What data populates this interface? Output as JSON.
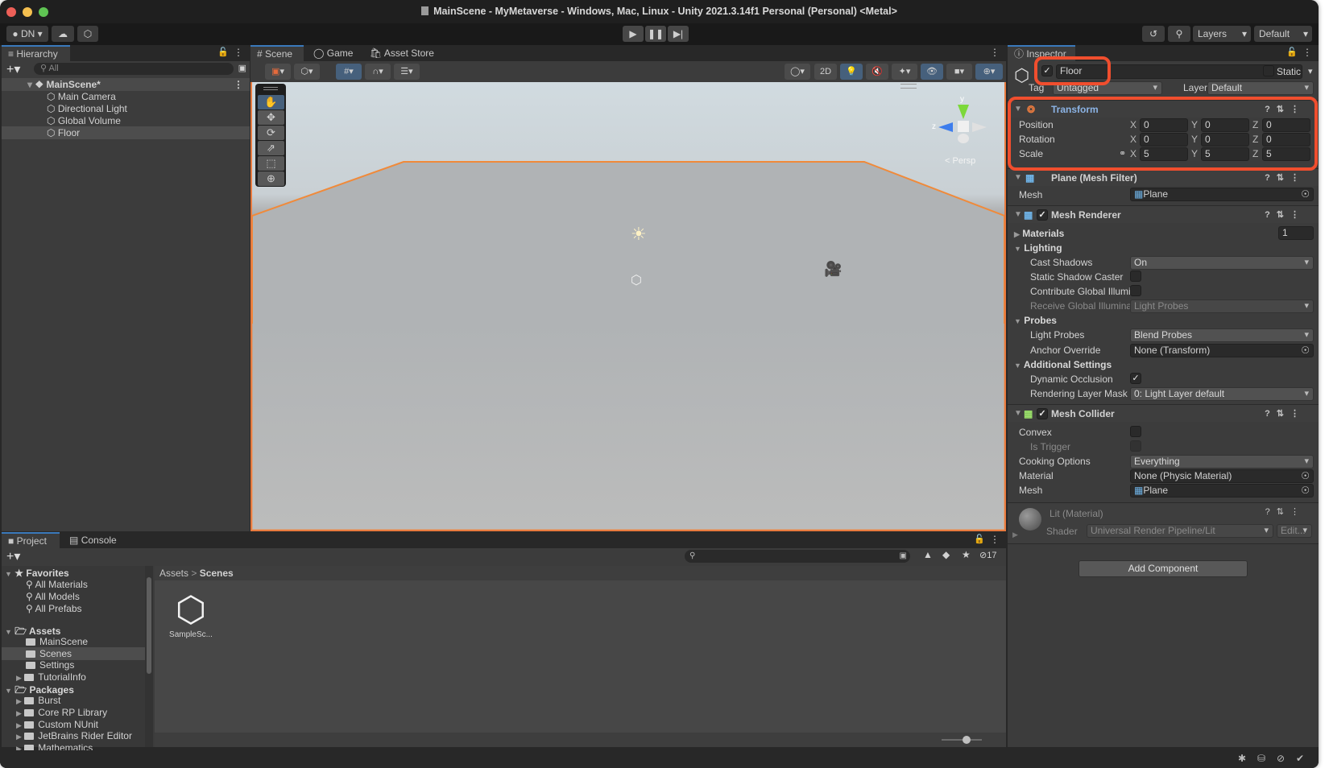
{
  "window": {
    "title": "MainScene - MyMetaverse - Windows, Mac, Linux - Unity 2021.3.14f1 Personal (Personal) <Metal>"
  },
  "toolbar": {
    "account_label": "DN",
    "layers_label": "Layers",
    "layout_label": "Default"
  },
  "hierarchy": {
    "tab_label": "Hierarchy",
    "search_placeholder": "All",
    "scene_name": "MainScene*",
    "items": [
      {
        "label": "Main Camera"
      },
      {
        "label": "Directional Light"
      },
      {
        "label": "Global Volume"
      },
      {
        "label": "Floor",
        "selected": true
      }
    ]
  },
  "scene_view": {
    "tabs": [
      {
        "label": "Scene",
        "active": true
      },
      {
        "label": "Game"
      },
      {
        "label": "Asset Store"
      }
    ],
    "mode_2d_label": "2D",
    "gizmo_y_label": "y",
    "gizmo_z_label": "z",
    "projection_label": "Persp"
  },
  "inspector": {
    "tab_label": "Inspector",
    "object_name": "Floor",
    "object_active": true,
    "static_label": "Static",
    "tag_label": "Tag",
    "tag_value": "Untagged",
    "layer_label": "Layer",
    "layer_value": "Default",
    "transform": {
      "title": "Transform",
      "rows": [
        {
          "label": "Position",
          "x": "0",
          "y": "0",
          "z": "0"
        },
        {
          "label": "Rotation",
          "x": "0",
          "y": "0",
          "z": "0"
        },
        {
          "label": "Scale",
          "x": "5",
          "y": "5",
          "z": "5"
        }
      ],
      "axis_x": "X",
      "axis_y": "Y",
      "axis_z": "Z"
    },
    "mesh_filter": {
      "title": "Plane (Mesh Filter)",
      "mesh_label": "Mesh",
      "mesh_value": "Plane"
    },
    "mesh_renderer": {
      "title": "Mesh Renderer",
      "enabled": true,
      "materials_label": "Materials",
      "materials_count": "1",
      "lighting_label": "Lighting",
      "cast_shadows_label": "Cast Shadows",
      "cast_shadows_value": "On",
      "static_shadow_label": "Static Shadow Caster",
      "contribute_gi_label": "Contribute Global Illumir",
      "receive_gi_label": "Receive Global Illuminat",
      "receive_gi_value": "Light Probes",
      "probes_label": "Probes",
      "light_probes_label": "Light Probes",
      "light_probes_value": "Blend Probes",
      "anchor_override_label": "Anchor Override",
      "anchor_override_value": "None (Transform)",
      "additional_label": "Additional Settings",
      "dynamic_occlusion_label": "Dynamic Occlusion",
      "dynamic_occlusion": true,
      "rendering_layer_label": "Rendering Layer Mask",
      "rendering_layer_value": "0: Light Layer default"
    },
    "mesh_collider": {
      "title": "Mesh Collider",
      "enabled": true,
      "convex_label": "Convex",
      "is_trigger_label": "Is Trigger",
      "cooking_label": "Cooking Options",
      "cooking_value": "Everything",
      "material_label": "Material",
      "material_value": "None (Physic Material)",
      "mesh_label": "Mesh",
      "mesh_value": "Plane"
    },
    "material": {
      "title": "Lit (Material)",
      "shader_label": "Shader",
      "shader_value": "Universal Render Pipeline/Lit",
      "edit_label": "Edit..."
    },
    "add_component_label": "Add Component"
  },
  "project": {
    "tabs": [
      {
        "label": "Project",
        "active": true
      },
      {
        "label": "Console"
      }
    ],
    "hidden_count": "17",
    "breadcrumb": [
      "Assets",
      "Scenes"
    ],
    "favorites_label": "Favorites",
    "favorites": [
      "All Materials",
      "All Models",
      "All Prefabs"
    ],
    "assets_label": "Assets",
    "assets": [
      {
        "label": "MainScene"
      },
      {
        "label": "Scenes",
        "selected": true
      },
      {
        "label": "Settings"
      },
      {
        "label": "TutorialInfo",
        "expandable": true
      }
    ],
    "packages_label": "Packages",
    "packages": [
      "Burst",
      "Core RP Library",
      "Custom NUnit",
      "JetBrains Rider Editor",
      "Mathematics"
    ],
    "files": [
      {
        "label": "SampleSc..."
      }
    ]
  },
  "colors": {
    "accent": "#3a79bb",
    "highlight_box": "#f04e2e",
    "selection_outline": "#f08a3a",
    "transform_title": "#8cb4e6"
  }
}
